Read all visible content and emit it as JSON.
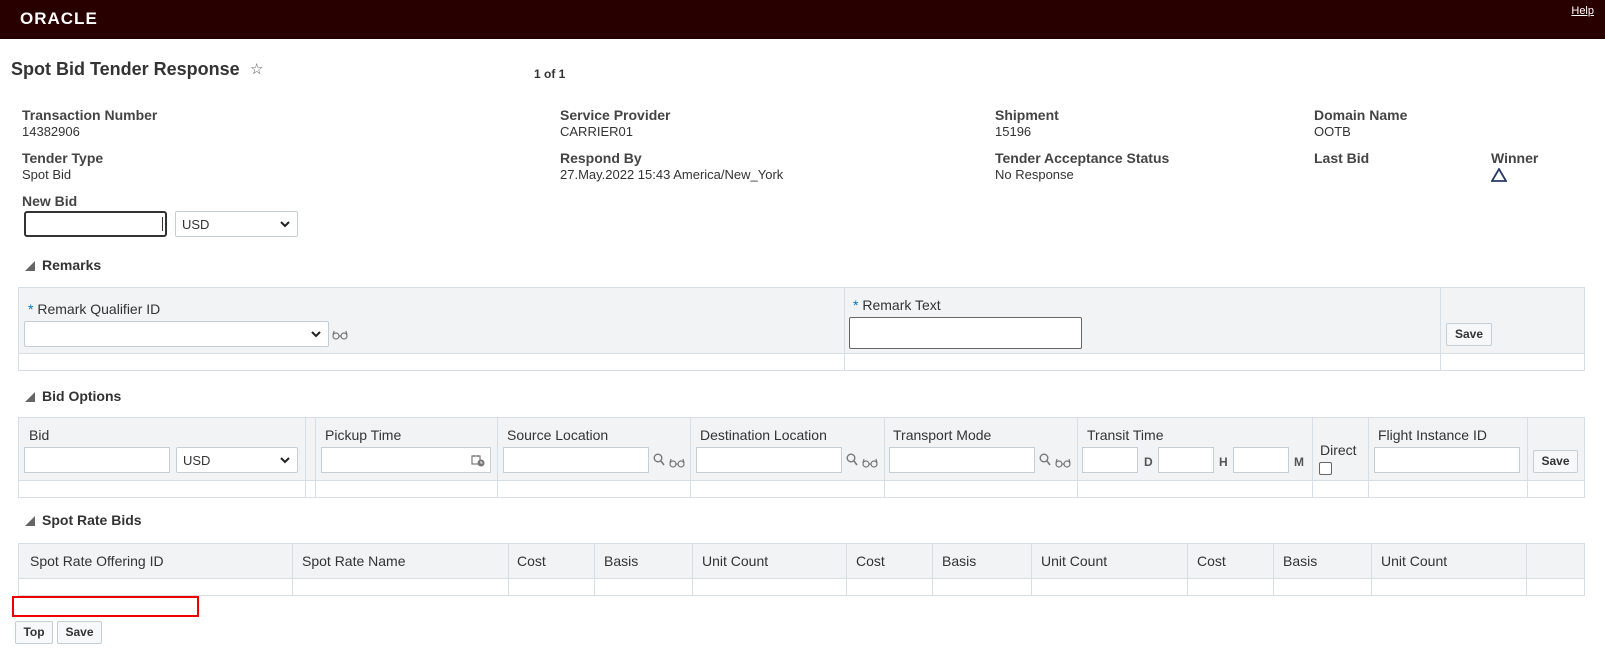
{
  "header": {
    "brand": "ORACLE",
    "help": "Help"
  },
  "page": {
    "title": "Spot Bid Tender Response",
    "pager": "1 of 1"
  },
  "fields": {
    "transaction_number": {
      "label": "Transaction Number",
      "value": "14382906"
    },
    "service_provider": {
      "label": "Service Provider",
      "value": "CARRIER01"
    },
    "shipment": {
      "label": "Shipment",
      "value": "15196"
    },
    "domain_name": {
      "label": "Domain Name",
      "value": "OOTB"
    },
    "tender_type": {
      "label": "Tender Type",
      "value": "Spot Bid"
    },
    "respond_by": {
      "label": "Respond By",
      "value": "27.May.2022 15:43 America/New_York"
    },
    "tender_acceptance_status": {
      "label": "Tender Acceptance Status",
      "value": "No Response"
    },
    "last_bid": {
      "label": "Last Bid",
      "value": ""
    },
    "winner": {
      "label": "Winner",
      "icon": "triangle-up-icon"
    },
    "new_bid": {
      "label": "New Bid",
      "value": "",
      "currency": "USD"
    }
  },
  "remarks": {
    "title": "Remarks",
    "required_mark": "*",
    "qualifier_label": "Remark Qualifier ID",
    "text_label": "Remark Text",
    "save": "Save"
  },
  "bid_options": {
    "title": "Bid Options",
    "columns": [
      "Bid",
      "Pickup Time",
      "Source Location",
      "Destination Location",
      "Transport Mode",
      "Transit Time",
      "Direct",
      "Flight Instance ID"
    ],
    "currency": "USD",
    "transit_units": [
      "D",
      "H",
      "M"
    ],
    "save": "Save"
  },
  "spot_rate_bids": {
    "title": "Spot Rate Bids",
    "columns": [
      "Spot Rate Offering ID",
      "Spot Rate Name",
      "Cost",
      "Basis",
      "Unit Count",
      "Cost",
      "Basis",
      "Unit Count",
      "Cost",
      "Basis",
      "Unit Count"
    ]
  },
  "footer": {
    "top": "Top",
    "save": "Save"
  }
}
